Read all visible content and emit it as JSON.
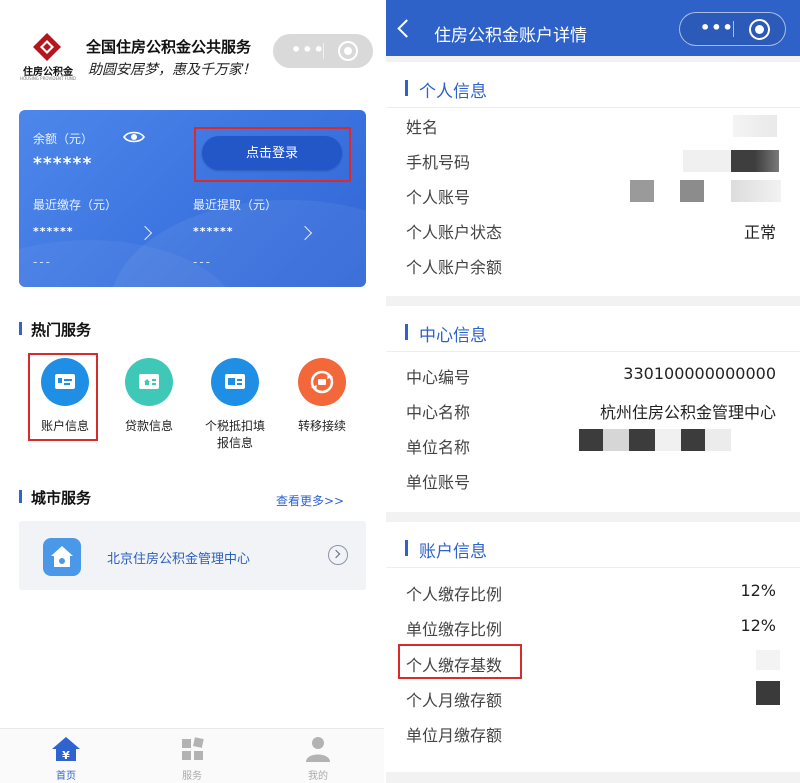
{
  "left": {
    "logo": {
      "cn": "住房公积金",
      "en": "HOUSING PROVIDENT FUND"
    },
    "app_title": "全国住房公积金公共服务",
    "app_slogan": "助圆安居梦，惠及千万家！",
    "capsule": {
      "menu_icon": "more-dots-icon",
      "close_icon": "target-circle-icon"
    },
    "balance_card": {
      "balance_label": "余额（元）",
      "balance_value": "******",
      "login_button": "点击登录",
      "recent_deposit_label": "最近缴存（元）",
      "recent_deposit_value": "******",
      "recent_deposit_sub": "---",
      "recent_withdraw_label": "最近提取（元）",
      "recent_withdraw_value": "******",
      "recent_withdraw_sub": "---"
    },
    "hot_services": {
      "title": "热门服务",
      "items": [
        {
          "label": "账户信息",
          "icon": "id-card-icon"
        },
        {
          "label": "贷款信息",
          "icon": "house-card-icon"
        },
        {
          "label": "个税抵扣填报信息",
          "icon": "tax-card-icon"
        },
        {
          "label": "转移接续",
          "icon": "transfer-icon"
        }
      ]
    },
    "city_services": {
      "title": "城市服务",
      "more_link": "查看更多>>",
      "card_label": "北京住房公积金管理中心"
    },
    "tabbar": [
      {
        "label": "首页",
        "icon": "home-yen-icon",
        "active": true
      },
      {
        "label": "服务",
        "icon": "grid-icon",
        "active": false
      },
      {
        "label": "我的",
        "icon": "user-icon",
        "active": false
      }
    ],
    "colors": {
      "accent": "#2e63d0",
      "highlight": "#d92b2b"
    }
  },
  "right": {
    "nav": {
      "title": "住房公积金账户详情"
    },
    "personal": {
      "title": "个人信息",
      "rows": [
        {
          "label": "姓名",
          "value": ""
        },
        {
          "label": "手机号码",
          "value": ""
        },
        {
          "label": "个人账号",
          "value": ""
        },
        {
          "label": "个人账户状态",
          "value": "正常"
        },
        {
          "label": "个人账户余额",
          "value": ""
        }
      ]
    },
    "center": {
      "title": "中心信息",
      "rows": [
        {
          "label": "中心编号",
          "value": "330100000000000"
        },
        {
          "label": "中心名称",
          "value": "杭州住房公积金管理中心"
        },
        {
          "label": "单位名称",
          "value": ""
        },
        {
          "label": "单位账号",
          "value": ""
        }
      ]
    },
    "account": {
      "title": "账户信息",
      "rows": [
        {
          "label": "个人缴存比例",
          "value": "12%"
        },
        {
          "label": "单位缴存比例",
          "value": "12%"
        },
        {
          "label": "个人缴存基数",
          "value": ""
        },
        {
          "label": "个人月缴存额",
          "value": ""
        },
        {
          "label": "单位月缴存额",
          "value": ""
        }
      ]
    }
  }
}
